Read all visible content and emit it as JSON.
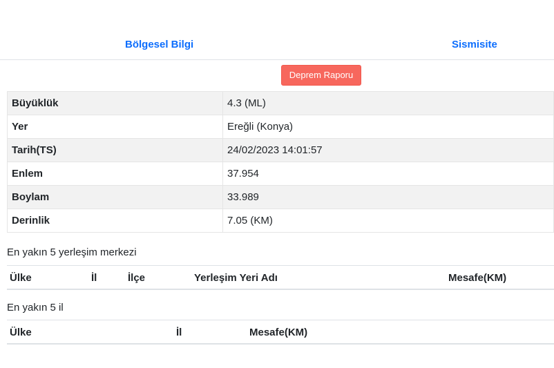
{
  "tabs": {
    "regional": "Bölgesel Bilgi",
    "seismicity": "Sismisite"
  },
  "report_button": "Deprem Raporu",
  "info": [
    {
      "key": "Büyüklük",
      "value": "4.3 (ML)"
    },
    {
      "key": "Yer",
      "value": "Ereğli (Konya)"
    },
    {
      "key": "Tarih(TS)",
      "value": "24/02/2023 14:01:57"
    },
    {
      "key": "Enlem",
      "value": "37.954"
    },
    {
      "key": "Boylam",
      "value": "33.989"
    },
    {
      "key": "Derinlik",
      "value": "7.05 (KM)"
    }
  ],
  "settlements": {
    "title": "En yakın 5 yerleşim merkezi",
    "columns": [
      "Ülke",
      "İl",
      "İlçe",
      "Yerleşim Yeri Adı",
      "Mesafe(KM)"
    ]
  },
  "provinces": {
    "title": "En yakın 5 il",
    "columns": [
      "Ülke",
      "İl",
      "Mesafe(KM)"
    ]
  }
}
